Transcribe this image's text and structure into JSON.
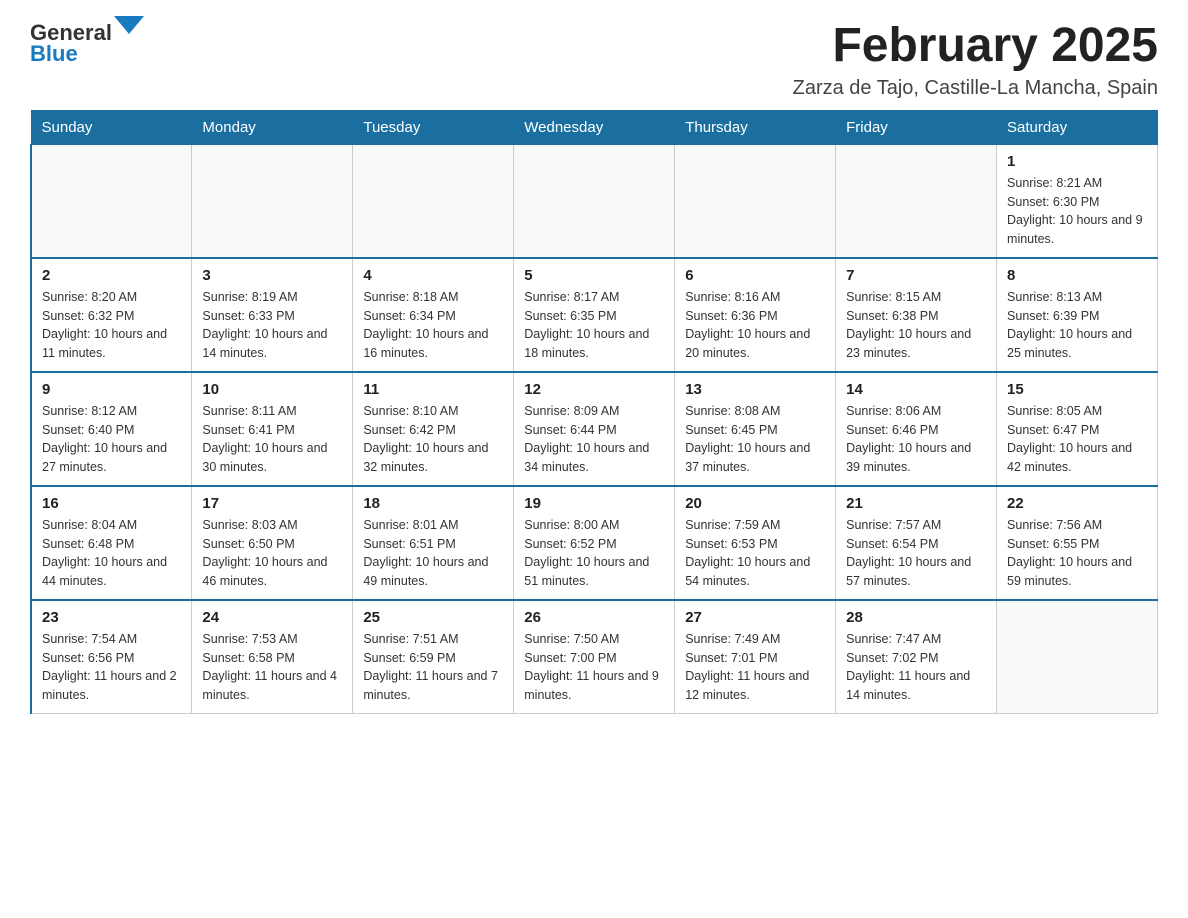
{
  "header": {
    "logo_general": "General",
    "logo_blue": "Blue",
    "month_title": "February 2025",
    "location": "Zarza de Tajo, Castille-La Mancha, Spain"
  },
  "days_of_week": [
    "Sunday",
    "Monday",
    "Tuesday",
    "Wednesday",
    "Thursday",
    "Friday",
    "Saturday"
  ],
  "weeks": [
    [
      {
        "day": "",
        "info": ""
      },
      {
        "day": "",
        "info": ""
      },
      {
        "day": "",
        "info": ""
      },
      {
        "day": "",
        "info": ""
      },
      {
        "day": "",
        "info": ""
      },
      {
        "day": "",
        "info": ""
      },
      {
        "day": "1",
        "info": "Sunrise: 8:21 AM\nSunset: 6:30 PM\nDaylight: 10 hours and 9 minutes."
      }
    ],
    [
      {
        "day": "2",
        "info": "Sunrise: 8:20 AM\nSunset: 6:32 PM\nDaylight: 10 hours and 11 minutes."
      },
      {
        "day": "3",
        "info": "Sunrise: 8:19 AM\nSunset: 6:33 PM\nDaylight: 10 hours and 14 minutes."
      },
      {
        "day": "4",
        "info": "Sunrise: 8:18 AM\nSunset: 6:34 PM\nDaylight: 10 hours and 16 minutes."
      },
      {
        "day": "5",
        "info": "Sunrise: 8:17 AM\nSunset: 6:35 PM\nDaylight: 10 hours and 18 minutes."
      },
      {
        "day": "6",
        "info": "Sunrise: 8:16 AM\nSunset: 6:36 PM\nDaylight: 10 hours and 20 minutes."
      },
      {
        "day": "7",
        "info": "Sunrise: 8:15 AM\nSunset: 6:38 PM\nDaylight: 10 hours and 23 minutes."
      },
      {
        "day": "8",
        "info": "Sunrise: 8:13 AM\nSunset: 6:39 PM\nDaylight: 10 hours and 25 minutes."
      }
    ],
    [
      {
        "day": "9",
        "info": "Sunrise: 8:12 AM\nSunset: 6:40 PM\nDaylight: 10 hours and 27 minutes."
      },
      {
        "day": "10",
        "info": "Sunrise: 8:11 AM\nSunset: 6:41 PM\nDaylight: 10 hours and 30 minutes."
      },
      {
        "day": "11",
        "info": "Sunrise: 8:10 AM\nSunset: 6:42 PM\nDaylight: 10 hours and 32 minutes."
      },
      {
        "day": "12",
        "info": "Sunrise: 8:09 AM\nSunset: 6:44 PM\nDaylight: 10 hours and 34 minutes."
      },
      {
        "day": "13",
        "info": "Sunrise: 8:08 AM\nSunset: 6:45 PM\nDaylight: 10 hours and 37 minutes."
      },
      {
        "day": "14",
        "info": "Sunrise: 8:06 AM\nSunset: 6:46 PM\nDaylight: 10 hours and 39 minutes."
      },
      {
        "day": "15",
        "info": "Sunrise: 8:05 AM\nSunset: 6:47 PM\nDaylight: 10 hours and 42 minutes."
      }
    ],
    [
      {
        "day": "16",
        "info": "Sunrise: 8:04 AM\nSunset: 6:48 PM\nDaylight: 10 hours and 44 minutes."
      },
      {
        "day": "17",
        "info": "Sunrise: 8:03 AM\nSunset: 6:50 PM\nDaylight: 10 hours and 46 minutes."
      },
      {
        "day": "18",
        "info": "Sunrise: 8:01 AM\nSunset: 6:51 PM\nDaylight: 10 hours and 49 minutes."
      },
      {
        "day": "19",
        "info": "Sunrise: 8:00 AM\nSunset: 6:52 PM\nDaylight: 10 hours and 51 minutes."
      },
      {
        "day": "20",
        "info": "Sunrise: 7:59 AM\nSunset: 6:53 PM\nDaylight: 10 hours and 54 minutes."
      },
      {
        "day": "21",
        "info": "Sunrise: 7:57 AM\nSunset: 6:54 PM\nDaylight: 10 hours and 57 minutes."
      },
      {
        "day": "22",
        "info": "Sunrise: 7:56 AM\nSunset: 6:55 PM\nDaylight: 10 hours and 59 minutes."
      }
    ],
    [
      {
        "day": "23",
        "info": "Sunrise: 7:54 AM\nSunset: 6:56 PM\nDaylight: 11 hours and 2 minutes."
      },
      {
        "day": "24",
        "info": "Sunrise: 7:53 AM\nSunset: 6:58 PM\nDaylight: 11 hours and 4 minutes."
      },
      {
        "day": "25",
        "info": "Sunrise: 7:51 AM\nSunset: 6:59 PM\nDaylight: 11 hours and 7 minutes."
      },
      {
        "day": "26",
        "info": "Sunrise: 7:50 AM\nSunset: 7:00 PM\nDaylight: 11 hours and 9 minutes."
      },
      {
        "day": "27",
        "info": "Sunrise: 7:49 AM\nSunset: 7:01 PM\nDaylight: 11 hours and 12 minutes."
      },
      {
        "day": "28",
        "info": "Sunrise: 7:47 AM\nSunset: 7:02 PM\nDaylight: 11 hours and 14 minutes."
      },
      {
        "day": "",
        "info": ""
      }
    ]
  ]
}
